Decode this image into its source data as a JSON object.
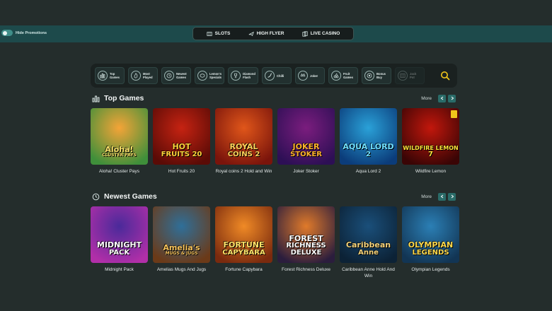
{
  "top_bar": {
    "hide_promotions_label": "Hide Promotions",
    "modes": [
      {
        "label": "SLOTS",
        "icon": "slots-icon"
      },
      {
        "label": "HIGH FLYER",
        "icon": "airplane-icon"
      },
      {
        "label": "LIVE CASINO",
        "icon": "cards-icon"
      }
    ]
  },
  "categories": [
    {
      "label": "Top Games",
      "icon": "bar-chart-icon"
    },
    {
      "label": "Most Played",
      "icon": "flame-icon"
    },
    {
      "label": "Newest Games",
      "icon": "clock-icon"
    },
    {
      "label": "Lemon's Specials",
      "icon": "lemon-icon"
    },
    {
      "label": "Diamond Flash",
      "icon": "trophy-icon"
    },
    {
      "label": "Chilli",
      "icon": "chilli-icon"
    },
    {
      "label": "Joker",
      "icon": "joker-icon"
    },
    {
      "label": "Fruit Games",
      "icon": "cherry-icon"
    },
    {
      "label": "Bonus Buy",
      "icon": "bonus-icon"
    },
    {
      "label": "Jack Pot",
      "icon": "slots-icon"
    }
  ],
  "sections": [
    {
      "title": "Top Games",
      "icon": "bar-chart-icon",
      "more_label": "More",
      "games": [
        {
          "name": "Aloha! Cluster Pays",
          "logo": [
            "Aloha!",
            "CLUSTER PAYS"
          ],
          "bg": [
            "#f4a437",
            "#3f8f3a"
          ],
          "logo_color": "#f7e06a"
        },
        {
          "name": "Hot Fruits 20",
          "logo": [
            "HOT",
            "FRUITS 20"
          ],
          "bg": [
            "#c62312",
            "#5a0b06"
          ],
          "logo_color": "#ffd33a"
        },
        {
          "name": "Royal coins 2 Hold and Win",
          "logo": [
            "ROYAL",
            "COINS 2"
          ],
          "bg": [
            "#e0561a",
            "#7a140b"
          ],
          "logo_color": "#ffd45a"
        },
        {
          "name": "Joker Stoker",
          "logo": [
            "JOKER",
            "STOKER"
          ],
          "bg": [
            "#7b1d7e",
            "#2d0f55"
          ],
          "logo_color": "#ffb22a"
        },
        {
          "name": "Aqua Lord 2",
          "logo": [
            "AQUA LORD",
            "2"
          ],
          "bg": [
            "#2aa1d8",
            "#0b3c7a"
          ],
          "logo_color": "#6fe0ff"
        },
        {
          "name": "Wildfire Lemon",
          "logo": [
            "WILDFIRE LEMON",
            "7"
          ],
          "bg": [
            "#c2170c",
            "#3a0505"
          ],
          "logo_color": "#ffe23a",
          "badge": true
        }
      ]
    },
    {
      "title": "Newest Games",
      "icon": "clock-icon",
      "more_label": "More",
      "games": [
        {
          "name": "Midnight Pack",
          "logo": [
            "MIDNIGHT",
            "PACK"
          ],
          "bg": [
            "#4a2a9a",
            "#b12fa8"
          ],
          "logo_color": "#ffffff"
        },
        {
          "name": "Amelias Mugs And Jugs",
          "logo": [
            "Amelia's",
            "MUGS & JUGS"
          ],
          "bg": [
            "#2f6f99",
            "#6b3a18"
          ],
          "logo_color": "#f6c25a"
        },
        {
          "name": "Fortune Capybara",
          "logo": [
            "FORTUNE",
            "CAPYBARA"
          ],
          "bg": [
            "#f08a26",
            "#7a2a0e"
          ],
          "logo_color": "#ffe46a"
        },
        {
          "name": "Forest Richness Deluxe",
          "logo": [
            "FOREST",
            "RICHNESS",
            "DELUXE"
          ],
          "bg": [
            "#e07a2a",
            "#2b1d3d"
          ],
          "logo_color": "#ffffff"
        },
        {
          "name": "Caribbean Anne Hold And Win",
          "logo": [
            "Caribbean",
            "Anne"
          ],
          "bg": [
            "#1a4f7a",
            "#0c2236"
          ],
          "logo_color": "#f4d27a"
        },
        {
          "name": "Olympian Legends",
          "logo": [
            "OLYMPIAN",
            "LEGENDS"
          ],
          "bg": [
            "#2b7fb5",
            "#123554"
          ],
          "logo_color": "#ffd84a"
        }
      ]
    }
  ],
  "colors": {
    "page_bg": "#242d2c",
    "top_bar_bg": "#1d4a4b",
    "accent": "#2a6c69",
    "search_icon": "#f0c51a"
  }
}
